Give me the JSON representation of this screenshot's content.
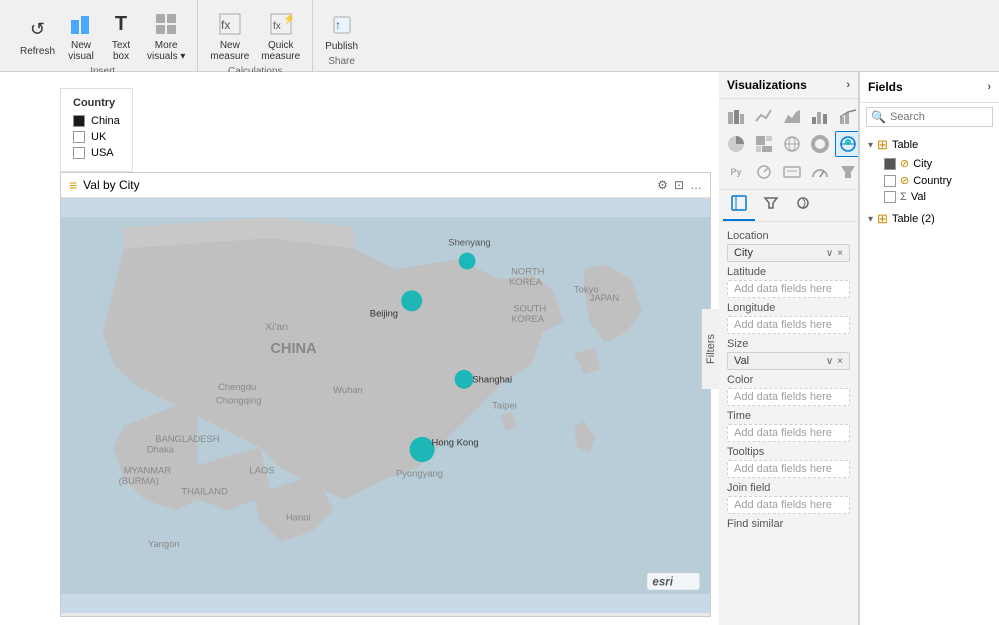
{
  "toolbar": {
    "groups": [
      {
        "label": "Insert",
        "buttons": [
          {
            "id": "refresh",
            "label": "Refresh",
            "icon": "↺"
          },
          {
            "id": "new-visual",
            "label": "New\nvisual",
            "icon": "📊"
          },
          {
            "id": "text-box",
            "label": "Text\nbox",
            "icon": "T"
          },
          {
            "id": "more-visuals",
            "label": "More\nvisuals ▾",
            "icon": "⊞"
          }
        ]
      },
      {
        "label": "Calculations",
        "buttons": [
          {
            "id": "new-measure",
            "label": "New\nmeasure",
            "icon": "𝑓x"
          },
          {
            "id": "quick-measure",
            "label": "Quick\nmeasure",
            "icon": "⚡"
          }
        ]
      },
      {
        "label": "Share",
        "buttons": [
          {
            "id": "publish",
            "label": "Publish",
            "icon": "↑"
          }
        ]
      }
    ]
  },
  "legend": {
    "title": "Country",
    "items": [
      {
        "label": "China",
        "filled": true
      },
      {
        "label": "UK",
        "filled": false
      },
      {
        "label": "USA",
        "filled": false
      }
    ]
  },
  "map": {
    "title": "Val by City",
    "points": [
      {
        "name": "Shenyang",
        "x": 72,
        "y": 12,
        "size": 14
      },
      {
        "name": "Beijing",
        "x": 55,
        "y": 18,
        "size": 16
      },
      {
        "name": "Shanghai",
        "x": 68,
        "y": 38,
        "size": 14
      },
      {
        "name": "Hong Kong",
        "x": 60,
        "y": 58,
        "size": 18
      }
    ]
  },
  "visualizations_panel": {
    "title": "Visualizations",
    "fields_title": "Fields"
  },
  "viz_icons": [
    "▦",
    "📈",
    "📊",
    "📉",
    "🔢",
    "⬡",
    "🗺",
    "⚫",
    "⬛",
    "🔷",
    "🔲",
    "○",
    "▣",
    "📋",
    "Ⓡ",
    "Py",
    "🔘",
    "💬",
    "⊡",
    "🔸",
    "⋯",
    ""
  ],
  "location_section": {
    "title": "Location",
    "field": "City",
    "latitude_label": "Latitude",
    "latitude_placeholder": "Add data fields here",
    "longitude_label": "Longitude",
    "longitude_placeholder": "Add data fields here",
    "size_label": "Size",
    "size_field": "Val",
    "color_label": "Color",
    "color_placeholder": "Add data fields here",
    "time_label": "Time",
    "time_placeholder": "Add data fields here",
    "tooltips_label": "Tooltips",
    "tooltips_placeholder": "Add data fields here",
    "join_field_label": "Join field",
    "join_field_placeholder": "Add data fields here",
    "find_similar_label": "Find similar"
  },
  "section_tabs": [
    {
      "id": "location",
      "label": "Location",
      "active": true
    },
    {
      "id": "filter",
      "label": "⚙",
      "active": false
    },
    {
      "id": "analytics",
      "label": "📊",
      "active": false
    }
  ],
  "fields": {
    "search_placeholder": "Search",
    "table": {
      "name": "Table",
      "fields": [
        {
          "name": "City",
          "type": "dimension",
          "checked": true
        },
        {
          "name": "Country",
          "type": "dimension",
          "checked": false
        },
        {
          "name": "Val",
          "type": "measure",
          "checked": false
        }
      ]
    },
    "table2": {
      "name": "Table (2)",
      "fields": []
    }
  },
  "filters_label": "Filters"
}
